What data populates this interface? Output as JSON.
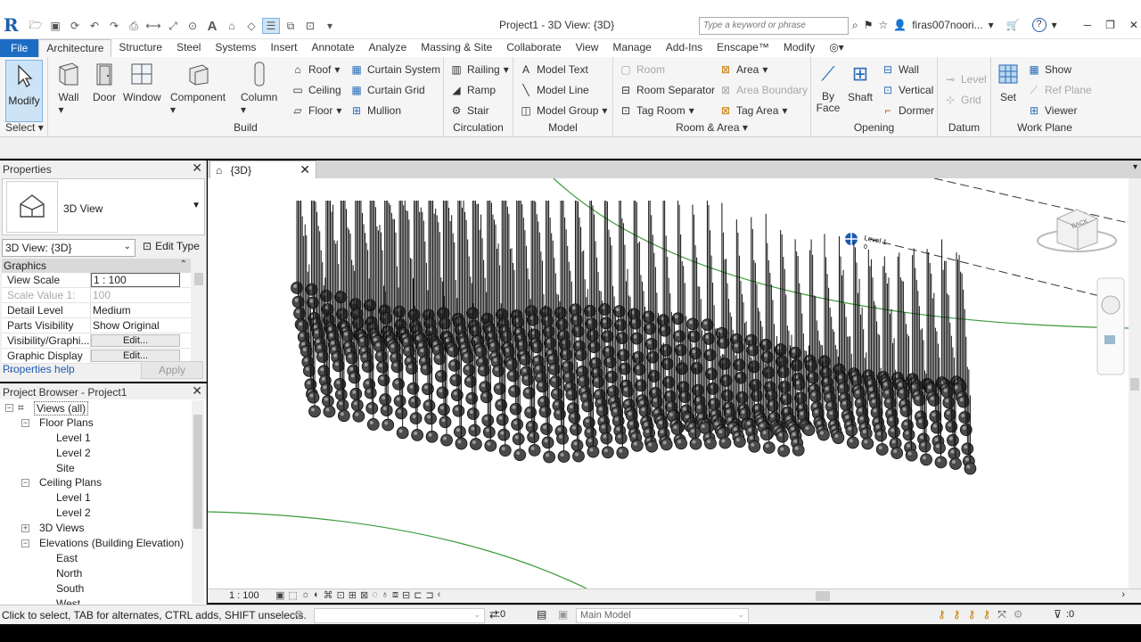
{
  "titlebar": {
    "logo": "R",
    "title": "Project1 - 3D View: {3D}",
    "search_placeholder": "Type a keyword or phrase",
    "user": "firas007noori...",
    "help": "?"
  },
  "tabs": [
    "File",
    "Architecture",
    "Structure",
    "Steel",
    "Systems",
    "Insert",
    "Annotate",
    "Analyze",
    "Massing & Site",
    "Collaborate",
    "View",
    "Manage",
    "Add-Ins",
    "Enscape™",
    "Modify"
  ],
  "ribbon": {
    "select": {
      "modify": "Modify",
      "title": "Select"
    },
    "build": {
      "title": "Build",
      "wall": "Wall",
      "door": "Door",
      "window": "Window",
      "component": "Component",
      "column": "Column",
      "roof": "Roof",
      "ceiling": "Ceiling",
      "floor": "Floor",
      "curtain_system": "Curtain System",
      "curtain_grid": "Curtain Grid",
      "mullion": "Mullion"
    },
    "circulation": {
      "title": "Circulation",
      "railing": "Railing",
      "ramp": "Ramp",
      "stair": "Stair"
    },
    "model": {
      "title": "Model",
      "model_text": "Model Text",
      "model_line": "Model Line",
      "model_group": "Model Group"
    },
    "room": {
      "title": "Room & Area",
      "room": "Room",
      "room_separator": "Room Separator",
      "tag_room": "Tag Room",
      "area": "Area",
      "area_boundary": "Area Boundary",
      "tag_area": "Tag Area"
    },
    "opening": {
      "title": "Opening",
      "by_face_1": "By",
      "by_face_2": "Face",
      "shaft": "Shaft",
      "wall": "Wall",
      "vertical": "Vertical",
      "dormer": "Dormer"
    },
    "datum": {
      "title": "Datum",
      "level": "Level",
      "grid": "Grid"
    },
    "workplane": {
      "title": "Work Plane",
      "set": "Set",
      "show": "Show",
      "ref_plane": "Ref Plane",
      "viewer": "Viewer"
    }
  },
  "properties": {
    "title": "Properties",
    "type_name": "3D View",
    "view_selector": "3D View: {3D}",
    "edit_type": "Edit Type",
    "group": "Graphics",
    "rows": [
      {
        "k": "View Scale",
        "v": "1 : 100"
      },
      {
        "k": "Scale Value    1:",
        "v": "100"
      },
      {
        "k": "Detail Level",
        "v": "Medium"
      },
      {
        "k": "Parts Visibility",
        "v": "Show Original"
      },
      {
        "k": "Visibility/Graphi...",
        "v": "Edit..."
      },
      {
        "k": "Graphic Display ...",
        "v": "Edit..."
      }
    ],
    "help_link": "Properties help",
    "apply": "Apply"
  },
  "browser": {
    "title": "Project Browser - Project1",
    "items": [
      "Views (all)",
      "Floor Plans",
      "Level 1",
      "Level 2",
      "Site",
      "Ceiling Plans",
      "Level 1",
      "Level 2",
      "3D Views",
      "Elevations (Building Elevation)",
      "East",
      "North",
      "South",
      "West"
    ]
  },
  "view": {
    "tab": "{3D}",
    "level_label": "Level 1",
    "level_value": "0",
    "viewcube": "BACK",
    "scale": "1 : 100"
  },
  "status": {
    "message": "Click to select, TAB for alternates, CTRL adds, SHIFT unselects.",
    "count_1": ":0",
    "model": "Main Model",
    "count_2": ":0"
  }
}
